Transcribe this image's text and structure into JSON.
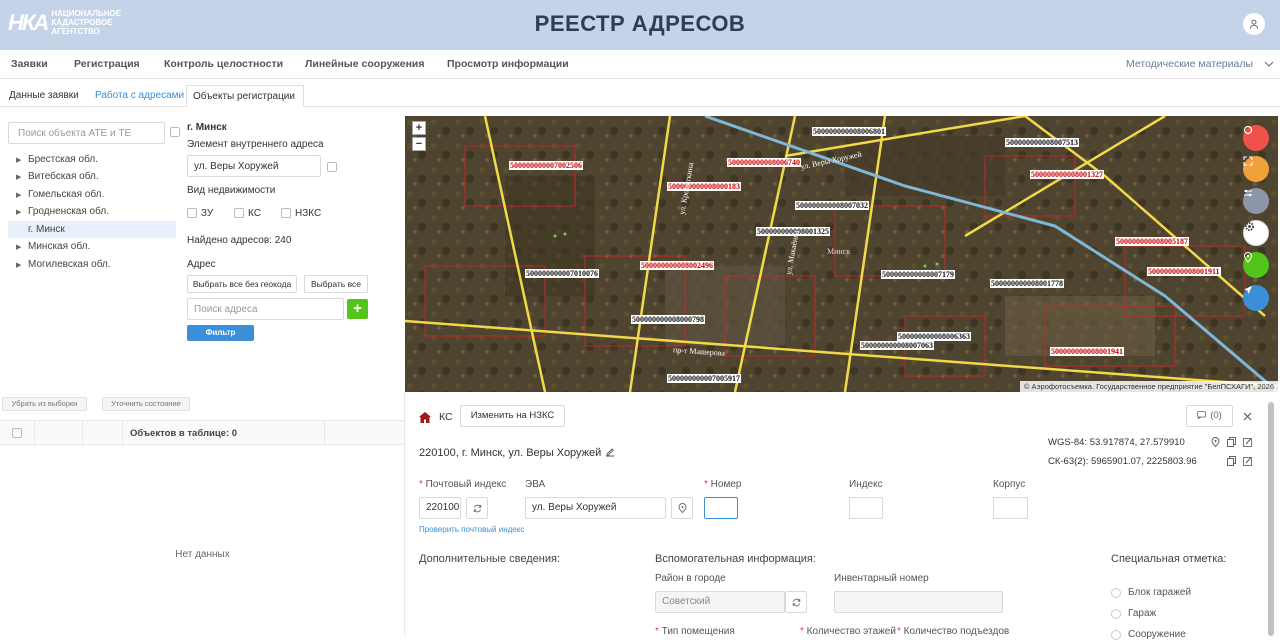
{
  "header": {
    "logo_mark": "НКА",
    "logo_text": "НАЦИОНАЛЬНОЕ\nКАДАСТРОВОЕ\nАГЕНТСТВО",
    "title": "РЕЕСТР АДРЕСОВ"
  },
  "menu": {
    "items": [
      "Заявки",
      "Регистрация",
      "Контроль целостности",
      "Линейные сооружения",
      "Просмотр информации"
    ],
    "right": "Методические материалы"
  },
  "subtabs": [
    "Данные заявки",
    "Работа с адресами",
    "Объекты регистрации"
  ],
  "ate_panel": {
    "search_placeholder": "Поиск объекта АТЕ и ТЕ",
    "regions": [
      "Брестская обл.",
      "Витебская обл.",
      "Гомельская обл.",
      "Гродненская обл.",
      "г. Минск",
      "Минская обл.",
      "Могилевская обл."
    ],
    "selected": "г. Минск"
  },
  "filter_panel": {
    "city": "г. Минск",
    "element_label": "Элемент внутреннего адреса",
    "element_value": "ул. Веры Хоружей",
    "property_type_label": "Вид недвижимости",
    "property_types": [
      "ЗУ",
      "КС",
      "НЗКС"
    ],
    "found": "Найдено адресов: 240",
    "address_label": "Адрес",
    "select_no_geocode": "Выбрать все без геокода",
    "select_all": "Выбрать все",
    "search_address_placeholder": "Поиск адреса",
    "plus": "+",
    "filter_button": "Фильтр"
  },
  "map": {
    "zoom_in": "+",
    "zoom_out": "−",
    "attribution": "© Аэрофотосъемка. Государственное предприятие \"БелПСХАГИ\", 2026",
    "district_label": "Минск",
    "street_labels": [
      "ул. Веры Хоружей",
      "пр-т Машерова",
      "ул. Кропоткина",
      "ул. Макаёнка"
    ],
    "red_parcels": [
      "500000000007002506",
      "500000000008006740",
      "500000000008000183",
      "500000000008001327",
      "500000000008005187",
      "500000000008001911",
      "500000000008002496",
      "500000000008001941"
    ],
    "black_parcels": [
      "500000000008006801",
      "500000000008007513",
      "500000000008007032",
      "500000000008001325",
      "500000000007010076",
      "500000000008007179",
      "500000000008001778",
      "500000000008000798",
      "500000000008006363",
      "500000000008007063",
      "500000000007005917"
    ],
    "colors": {
      "zoom_red": "#f0524a",
      "orange": "#f0a13a",
      "gray": "#8c96a8",
      "green": "#52c41a",
      "blue": "#3a8fd8"
    }
  },
  "table": {
    "remove_button": "Убрать из выборки",
    "refine_button": "Уточнить состояние",
    "count_label": "Объектов в таблице: 0",
    "empty": "Нет данных"
  },
  "detail": {
    "type": "КС",
    "change_button": "Изменить на НЗКС",
    "history_count": "(0)",
    "address": "220100, г. Минск, ул. Веры Хоружей",
    "wgs": "WGS-84: 53.917874, 27.579910",
    "sk": "СК-63(2): 5965901.07, 2225803.96",
    "postal_label": "Почтовый индекс",
    "postal_value": "220100",
    "check_postal": "Проверить почтовый индекс",
    "eva_label": "ЭВА",
    "eva_value": "ул. Веры Хоружей",
    "number_label": "Номер",
    "index_label": "Индекс",
    "corpus_label": "Корпус",
    "additional_title": "Дополнительные сведения:",
    "aux_title": "Вспомогательная информация:",
    "district_label": "Район в городе",
    "district_value": "Советский",
    "inventory_label": "Инвентарный номер",
    "room_type_label": "Тип помещения",
    "floors_label": "Количество этажей",
    "entrances_label": "Количество подъездов",
    "special_title": "Специальная отметка:",
    "special_options": [
      "Блок гаражей",
      "Гараж",
      "Сооружение"
    ]
  }
}
